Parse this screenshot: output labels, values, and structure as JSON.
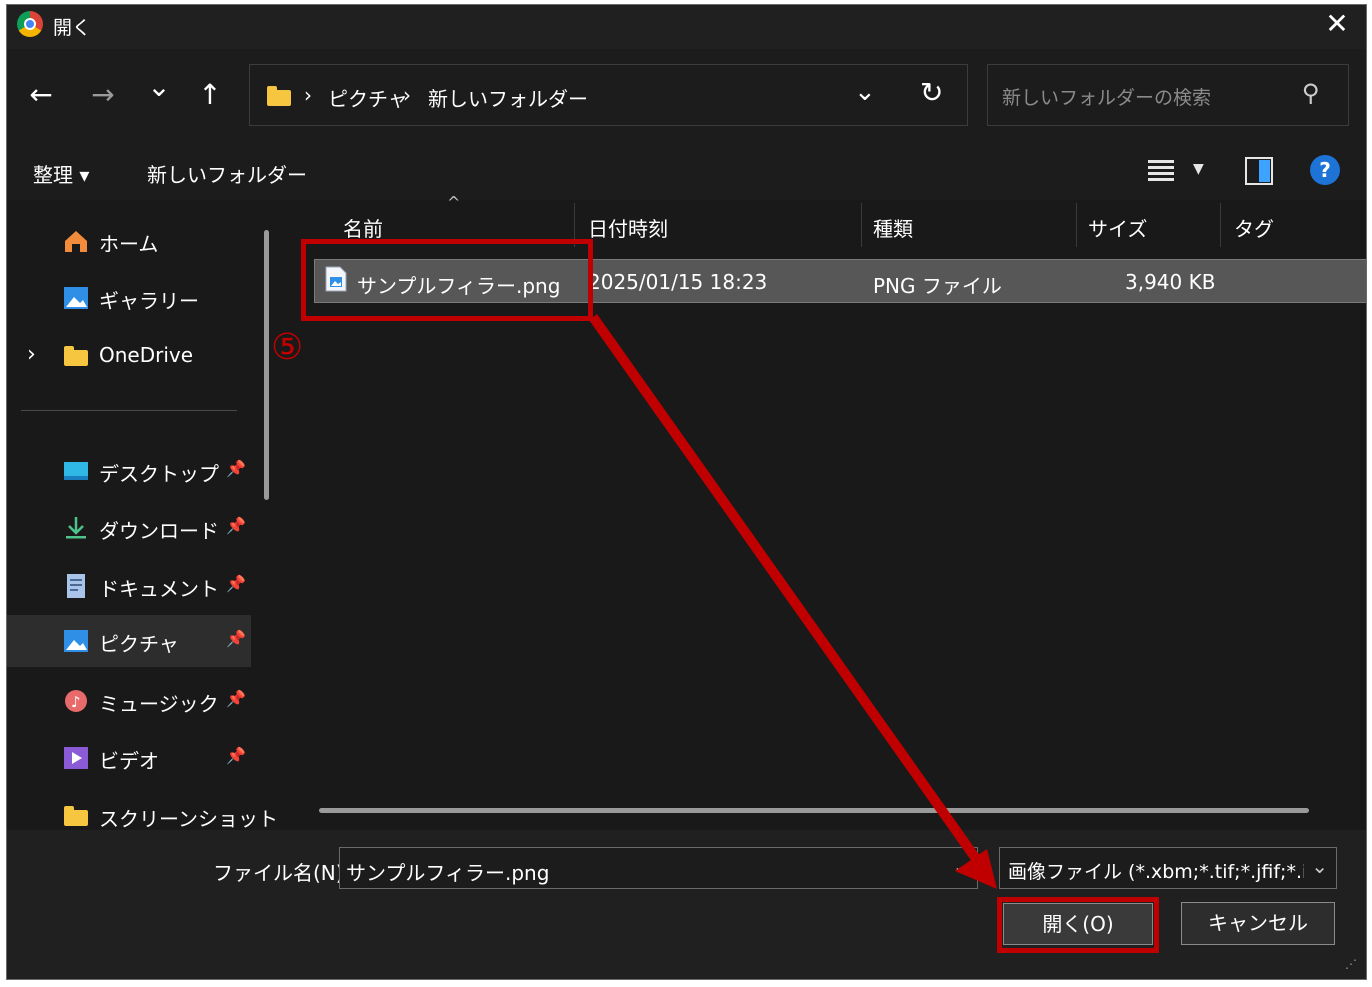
{
  "window": {
    "title": "開く",
    "close_icon": "✕"
  },
  "nav": {
    "back_icon": "←",
    "forward_icon": "→",
    "recent_icon": "⌄",
    "up_icon": "↑",
    "breadcrumb": [
      "ピクチャ",
      "新しいフォルダー"
    ],
    "separator": "›",
    "dropdown_icon": "⌄",
    "refresh_icon": "↻",
    "search_placeholder": "新しいフォルダーの検索",
    "search_icon": "⚲"
  },
  "toolbar": {
    "organize": "整理 ▾",
    "new_folder": "新しいフォルダー",
    "help": "?"
  },
  "sidebar": {
    "expand_icon": "›",
    "pin_icon": "📌",
    "items": [
      {
        "label": "ホーム",
        "icon": "home-icon"
      },
      {
        "label": "ギャラリー",
        "icon": "gallery-icon"
      },
      {
        "label": "OneDrive",
        "icon": "folder-icon"
      },
      {
        "label": "デスクトップ",
        "icon": "desktop-icon"
      },
      {
        "label": "ダウンロード",
        "icon": "download-icon"
      },
      {
        "label": "ドキュメント",
        "icon": "document-icon"
      },
      {
        "label": "ピクチャ",
        "icon": "pictures-icon"
      },
      {
        "label": "ミュージック",
        "icon": "music-icon"
      },
      {
        "label": "ビデオ",
        "icon": "video-icon"
      },
      {
        "label": "スクリーンショット",
        "icon": "folder-icon"
      }
    ]
  },
  "columns": [
    "名前",
    "日付時刻",
    "種類",
    "サイズ",
    "タグ"
  ],
  "sort_icon": "^",
  "files": [
    {
      "name": "サンプルフィラー.png",
      "date": "2025/01/15 18:23",
      "type": "PNG ファイル",
      "size": "3,940 KB"
    }
  ],
  "annotation": {
    "step": "⑤",
    "color": "#c00000"
  },
  "bottom": {
    "filename_label": "ファイル名(N):",
    "filename_value": "サンプルフィラー.png",
    "filetype_value": "画像ファイル (*.xbm;*.tif;*.jfif;*.ico;",
    "open_button": "開く(O)",
    "cancel_button": "キャンセル"
  }
}
